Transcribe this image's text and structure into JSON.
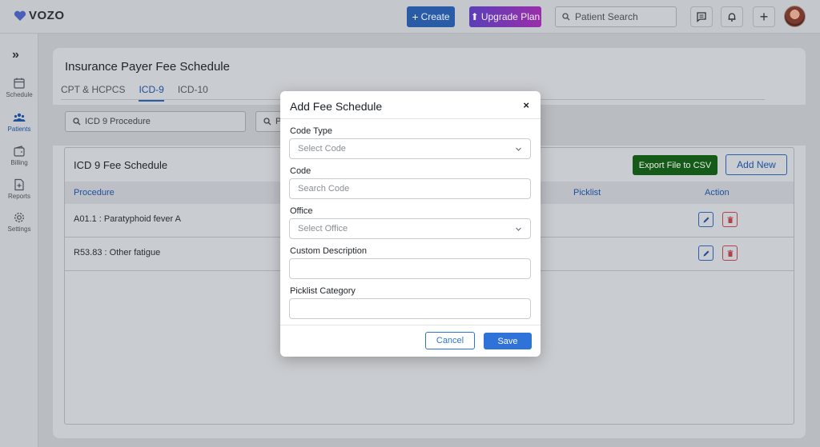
{
  "header": {
    "logo": "VOZO",
    "create_label": "Create",
    "upgrade_label": "Upgrade Plan",
    "search_placeholder": "Patient Search"
  },
  "sidebar": {
    "items": [
      {
        "label": "Schedule",
        "icon": "calendar-icon"
      },
      {
        "label": "Patients",
        "icon": "patients-icon"
      },
      {
        "label": "Billing",
        "icon": "wallet-icon"
      },
      {
        "label": "Reports",
        "icon": "report-icon"
      },
      {
        "label": "Settings",
        "icon": "gear-icon"
      }
    ]
  },
  "page": {
    "title": "Insurance Payer Fee Schedule",
    "tabs": [
      {
        "label": "CPT & HCPCS",
        "active": false
      },
      {
        "label": "ICD-9",
        "active": true
      },
      {
        "label": "ICD-10",
        "active": false
      }
    ],
    "filters": {
      "procedure_placeholder": "ICD 9 Procedure",
      "second_placeholder": "P"
    }
  },
  "table": {
    "title": "ICD 9 Fee Schedule",
    "export_label": "Export File to CSV",
    "add_new_label": "Add New",
    "columns": [
      "Procedure",
      "Picklist",
      "Action"
    ],
    "rows": [
      {
        "procedure": "A01.1 : Paratyphoid fever A"
      },
      {
        "procedure": "R53.83 : Other fatigue"
      }
    ]
  },
  "modal": {
    "title": "Add Fee Schedule",
    "close": "×",
    "fields": {
      "code_type": {
        "label": "Code Type",
        "placeholder": "Select Code"
      },
      "code": {
        "label": "Code",
        "placeholder": "Search Code"
      },
      "office": {
        "label": "Office",
        "placeholder": "Select Office"
      },
      "custom_description": {
        "label": "Custom Description",
        "value": ""
      },
      "picklist_category": {
        "label": "Picklist Category",
        "value": ""
      }
    },
    "cancel_label": "Cancel",
    "save_label": "Save"
  },
  "colors": {
    "primary": "#2f73d9",
    "export_green": "#1e7a23",
    "delete_red": "#d9534f"
  }
}
